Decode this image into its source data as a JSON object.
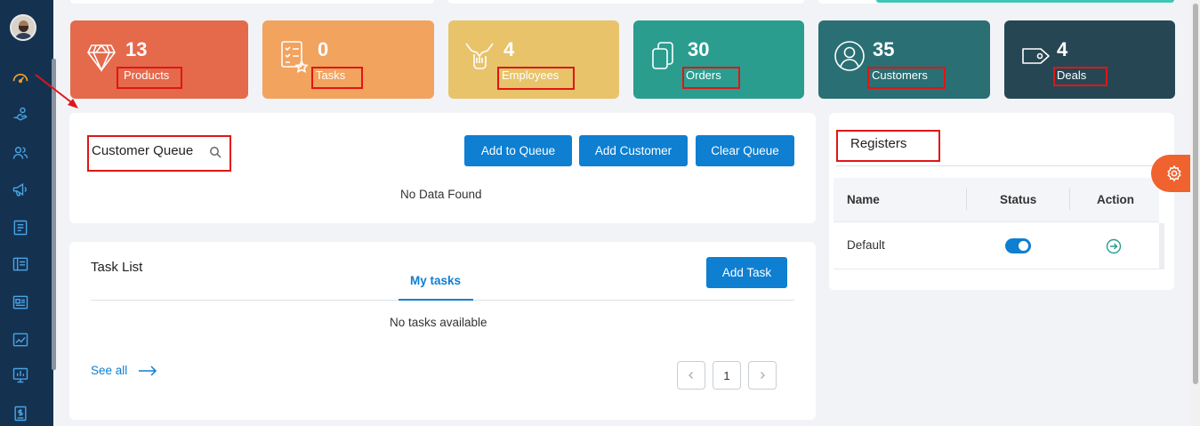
{
  "stats": [
    {
      "value": "13",
      "label": "Products",
      "color": "#e5694b",
      "icon": "diamond-icon"
    },
    {
      "value": "0",
      "label": "Tasks",
      "color": "#f2a35e",
      "icon": "checklist-icon"
    },
    {
      "value": "4",
      "label": "Employees",
      "color": "#e8c36a",
      "icon": "handshake-icon"
    },
    {
      "value": "30",
      "label": "Orders",
      "color": "#2a9d8f",
      "icon": "copy-icon"
    },
    {
      "value": "35",
      "label": "Customers",
      "color": "#2a6f73",
      "icon": "user-circle-icon"
    },
    {
      "value": "4",
      "label": "Deals",
      "color": "#264653",
      "icon": "tag-icon"
    }
  ],
  "queue": {
    "title": "Customer Queue",
    "add_to_queue": "Add to Queue",
    "add_customer": "Add Customer",
    "clear_queue": "Clear Queue",
    "empty": "No Data Found"
  },
  "tasks": {
    "title": "Task List",
    "tab": "My tasks",
    "add_task": "Add Task",
    "empty": "No tasks available",
    "see_all": "See all",
    "page": "1"
  },
  "registers": {
    "title": "Registers",
    "columns": [
      "Name",
      "Status",
      "Action"
    ],
    "rows": [
      {
        "name": "Default",
        "status": "on"
      }
    ]
  },
  "sidebar": {
    "icons": [
      "dashboard-icon",
      "hand-coins-icon",
      "users-icon",
      "megaphone-icon",
      "list-icon",
      "book-icon",
      "id-card-icon",
      "trend-chart-icon",
      "presentation-chart-icon",
      "invoice-icon"
    ]
  },
  "colors": {
    "primary": "#0e7fd1",
    "sidebar": "#143250",
    "accent": "#f0622e"
  }
}
